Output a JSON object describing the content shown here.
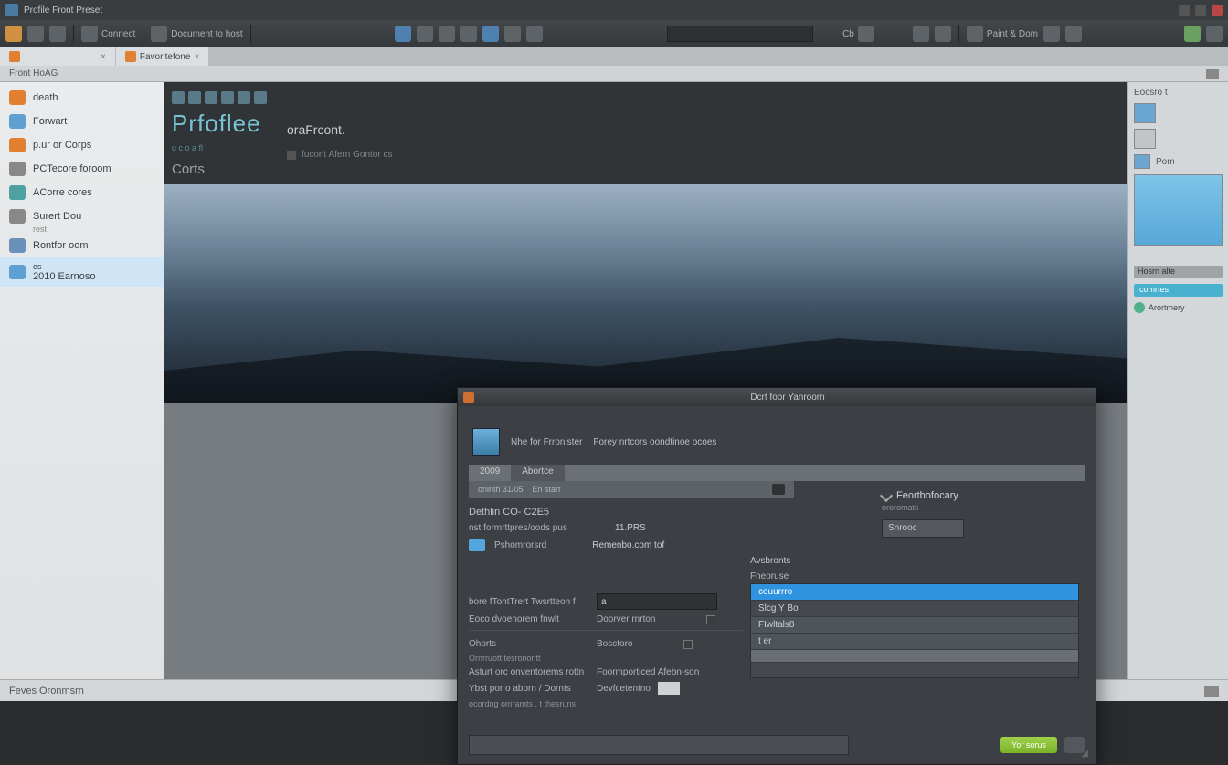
{
  "titlebar": {
    "text": "Profile Front Preset"
  },
  "maintool": {
    "group1": "Connect",
    "group2": "Document to host",
    "right1": "Paint & Dom",
    "btn_cb": "Cb"
  },
  "tabs": [
    {
      "label": ""
    },
    {
      "label": "Favoritefone"
    }
  ],
  "subheader": {
    "text": "Front HoAG"
  },
  "sidebar": {
    "items": [
      {
        "label": "death"
      },
      {
        "label": "Forwart"
      },
      {
        "label": "p.ur or Corps"
      },
      {
        "label": "PCTecore foroom"
      },
      {
        "label": "ACorre cores",
        "sub": ""
      },
      {
        "label": "Surert Dou",
        "sub": "rest"
      },
      {
        "label": "Rontfor oom"
      },
      {
        "label": "os",
        "sub2": "2010 Earnoso"
      }
    ]
  },
  "hero": {
    "title": "Prfoflee",
    "sub": "u c o a fl",
    "sub2": "Corts",
    "right_h1": "oraFrcont.",
    "right_h2": "fucont Afern Gontor cs"
  },
  "rightpanel": {
    "head": "Eocsro t",
    "row_label": "Pom",
    "sec": "Hosrn alte",
    "pill": "comrtes",
    "item": "Arortmery"
  },
  "statusbar": {
    "text": "Feves Oronmsrn"
  },
  "modal": {
    "title": "Dcrt foor  Yanroorn",
    "header_l1": "Nhe for Frronlster",
    "header_l2": "Forey nrtcors oondtinoe ocoes",
    "tabs": {
      "a": "2009",
      "b": "Abortce"
    },
    "subbar": {
      "a": "oninth 31/05",
      "b": "En start"
    },
    "section_title": "Dethlin CO- C2E5",
    "row1_l": "nst  formrttpres/oods pus",
    "row1_r": "11.PRS",
    "row2_l": "Pshomrorsrd",
    "row2_r": "Remenbo.com tof",
    "advanced_label": "Avsbronts",
    "rightcol": {
      "title": "Feortbofocary",
      "sub": "ororomats",
      "value": "Snrooc"
    },
    "list": {
      "h1": "Fneoruse",
      "rows": [
        "couurrro",
        "Slcg  Y Bo",
        "FIwltals8",
        "t er"
      ]
    },
    "leftform": {
      "f1_l": "bore fTontTrert Twsrtteon f",
      "f1_v": "a",
      "f1b": "Doorver rnrton",
      "f2_l": "Eoco dvoenorem fnwlt",
      "g1": "Ohorts",
      "g1r": "Bosctoro",
      "g1sub": "Ornrruott tesronoritt",
      "g2_l": "Asturt orc onventorems rottn",
      "g2_r": "Foormporticed   Afebn-son",
      "g3_l": "Ybst por o aborn / Dornts",
      "g3_r": "Devfcetentno",
      "g3sub": "ocordng omramts  . t  thesruns"
    },
    "footer": {
      "ok": "Yor sorus"
    }
  }
}
